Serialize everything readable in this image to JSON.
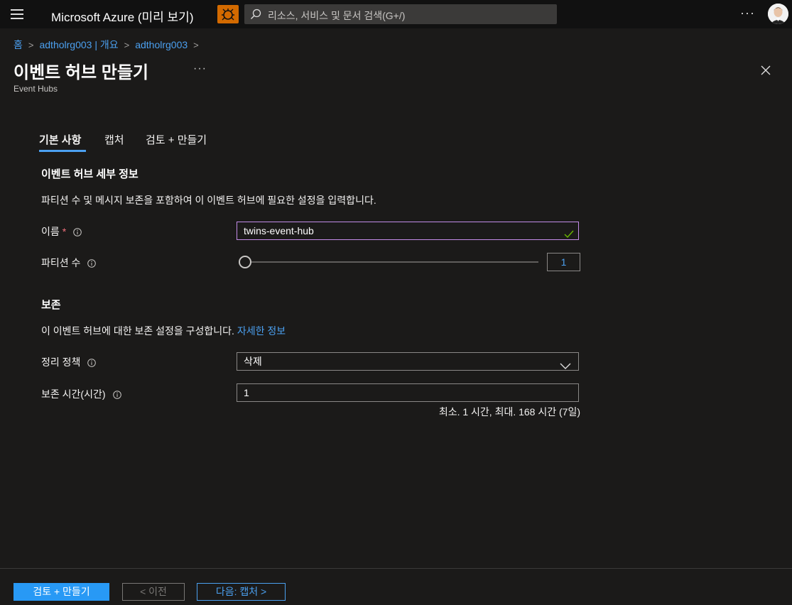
{
  "topbar": {
    "brand": "Microsoft Azure (미리 보기)",
    "search_placeholder": "리소스, 서비스 및 문서 검색(G+/)",
    "more": "···"
  },
  "breadcrumb": [
    {
      "label": "홈"
    },
    {
      "label": "adtholrg003 | 개요"
    },
    {
      "label": "adtholrg003"
    }
  ],
  "page": {
    "title": "이벤트 허브 만들기",
    "more": "···",
    "subtitle": "Event Hubs"
  },
  "tabs": [
    {
      "label": "기본 사항",
      "active": true
    },
    {
      "label": "캡처",
      "active": false
    },
    {
      "label": "검토 + 만들기",
      "active": false
    }
  ],
  "details": {
    "title": "이벤트 허브 세부 정보",
    "description": "파티션 수 및 메시지 보존을 포함하여 이 이벤트 허브에 필요한 설정을 입력합니다."
  },
  "form": {
    "name_label": "이름",
    "name_required": "*",
    "name_value": "twins-event-hub",
    "partition_label": "파티션 수",
    "partition_value": "1",
    "partition_fraction": 0
  },
  "retention": {
    "title": "보존",
    "description": "이 이벤트 허브에 대한 보존 설정을 구성합니다.",
    "learn_more": "자세한 정보",
    "cleanup_label": "정리 정책",
    "cleanup_value": "삭제",
    "time_label": "보존 시간(시간)",
    "time_value": "1",
    "hint": "최소. 1 시간, 최대. 168 시간 (7일)"
  },
  "footer": {
    "review_create": "검토 + 만들기",
    "previous": "< 이전",
    "next": "다음: 캡처 >"
  },
  "colors": {
    "accent": "#2899f5",
    "link": "#4ba0f0",
    "valid_border": "#c38ce8",
    "required": "#f1707b",
    "notification": "#d36a00"
  }
}
